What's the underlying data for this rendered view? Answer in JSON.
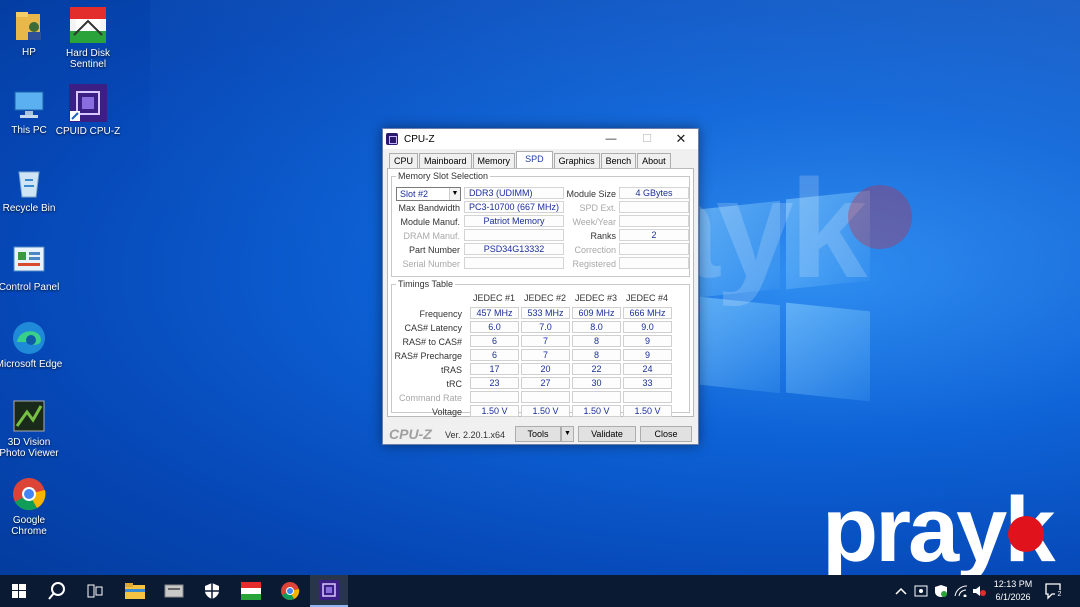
{
  "desktop": {
    "icons": [
      {
        "label": "HP"
      },
      {
        "label": "Hard Disk Sentinel"
      },
      {
        "label": "This PC"
      },
      {
        "label": "CPUID CPU-Z"
      },
      {
        "label": "Recycle Bin"
      },
      {
        "label": "Control Panel"
      },
      {
        "label": "Microsoft Edge"
      },
      {
        "label": "3D Vision Photo Viewer"
      },
      {
        "label": "Google Chrome"
      }
    ],
    "watermark": "prayk"
  },
  "window": {
    "title": "CPU-Z",
    "tabs": [
      {
        "label": "CPU"
      },
      {
        "label": "Mainboard"
      },
      {
        "label": "Memory"
      },
      {
        "label": "SPD"
      },
      {
        "label": "Graphics"
      },
      {
        "label": "Bench"
      },
      {
        "label": "About"
      }
    ],
    "active_tab": "SPD",
    "slot_group": {
      "title": "Memory Slot Selection",
      "slot_value": "Slot #2",
      "module_type": "DDR3 (UDIMM)",
      "labels": {
        "module_size": "Module Size",
        "max_bandwidth": "Max Bandwidth",
        "spd_ext": "SPD Ext.",
        "module_manuf": "Module Manuf.",
        "week_year": "Week/Year",
        "dram_manuf": "DRAM Manuf.",
        "ranks": "Ranks",
        "part_number": "Part Number",
        "correction": "Correction",
        "serial_number": "Serial Number",
        "registered": "Registered"
      },
      "values": {
        "module_size": "4 GBytes",
        "max_bandwidth": "PC3-10700 (667 MHz)",
        "spd_ext": "",
        "module_manuf": "Patriot Memory",
        "week_year": "",
        "dram_manuf": "",
        "ranks": "2",
        "part_number": "PSD34G13332",
        "correction": "",
        "serial_number": "",
        "registered": ""
      }
    },
    "timings": {
      "title": "Timings Table",
      "columns": [
        "JEDEC #1",
        "JEDEC #2",
        "JEDEC #3",
        "JEDEC #4"
      ],
      "rows": [
        {
          "label": "Frequency",
          "values": [
            "457 MHz",
            "533 MHz",
            "609 MHz",
            "666 MHz"
          ]
        },
        {
          "label": "CAS# Latency",
          "values": [
            "6.0",
            "7.0",
            "8.0",
            "9.0"
          ]
        },
        {
          "label": "RAS# to CAS#",
          "values": [
            "6",
            "7",
            "8",
            "9"
          ]
        },
        {
          "label": "RAS# Precharge",
          "values": [
            "6",
            "7",
            "8",
            "9"
          ]
        },
        {
          "label": "tRAS",
          "values": [
            "17",
            "20",
            "22",
            "24"
          ]
        },
        {
          "label": "tRC",
          "values": [
            "23",
            "27",
            "30",
            "33"
          ]
        },
        {
          "label": "Command Rate",
          "values": [
            "",
            "",
            "",
            ""
          ]
        },
        {
          "label": "Voltage",
          "values": [
            "1.50 V",
            "1.50 V",
            "1.50 V",
            "1.50 V"
          ]
        }
      ]
    },
    "footer": {
      "brand": "CPU-Z",
      "version": "Ver. 2.20.1.x64",
      "tools_label": "Tools",
      "validate_label": "Validate",
      "close_label": "Close"
    }
  },
  "taskbar": {
    "time": "12:13 PM",
    "date": "6/1/2026",
    "notification_count": "2"
  }
}
